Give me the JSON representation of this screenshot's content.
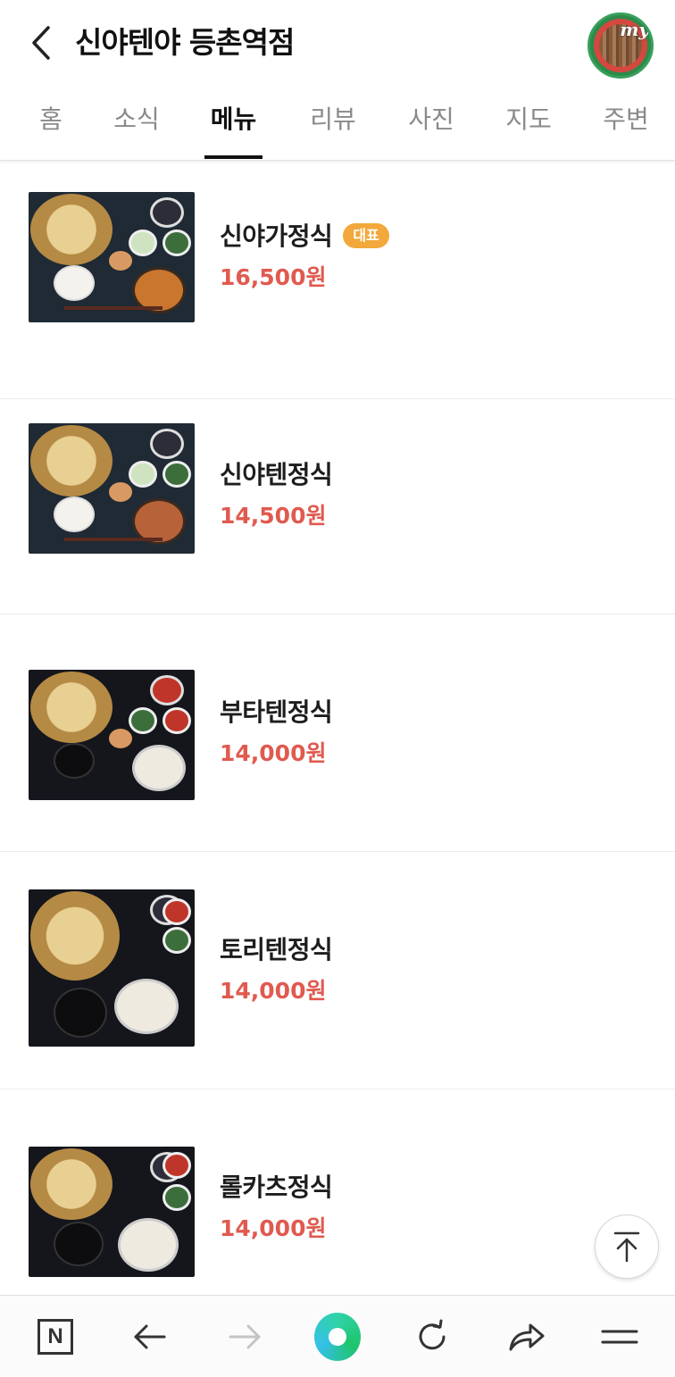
{
  "header": {
    "title": "신야텐야 등촌역점",
    "my_label": "my"
  },
  "tabs": [
    {
      "label": "홈",
      "active": false
    },
    {
      "label": "소식",
      "active": false
    },
    {
      "label": "메뉴",
      "active": true
    },
    {
      "label": "리뷰",
      "active": false
    },
    {
      "label": "사진",
      "active": false
    },
    {
      "label": "지도",
      "active": false
    },
    {
      "label": "주변",
      "active": false
    }
  ],
  "menu": [
    {
      "name": "신야가정식",
      "badge": "대표",
      "price": "16,500원"
    },
    {
      "name": "신야텐정식",
      "price": "14,500원"
    },
    {
      "name": "부타텐정식",
      "price": "14,000원"
    },
    {
      "name": "토리텐정식",
      "price": "14,000원"
    },
    {
      "name": "롤카츠정식",
      "price": "14,000원"
    }
  ],
  "colors": {
    "price": "#e05a4f",
    "badge": "#f2a83a",
    "active_tab": "#111111"
  },
  "bottom_nav": {
    "icons": [
      "naver-home-icon",
      "back-arrow-icon",
      "forward-arrow-icon",
      "green-dot-icon",
      "refresh-icon",
      "share-icon",
      "menu-icon"
    ],
    "home_glyph": "N"
  }
}
